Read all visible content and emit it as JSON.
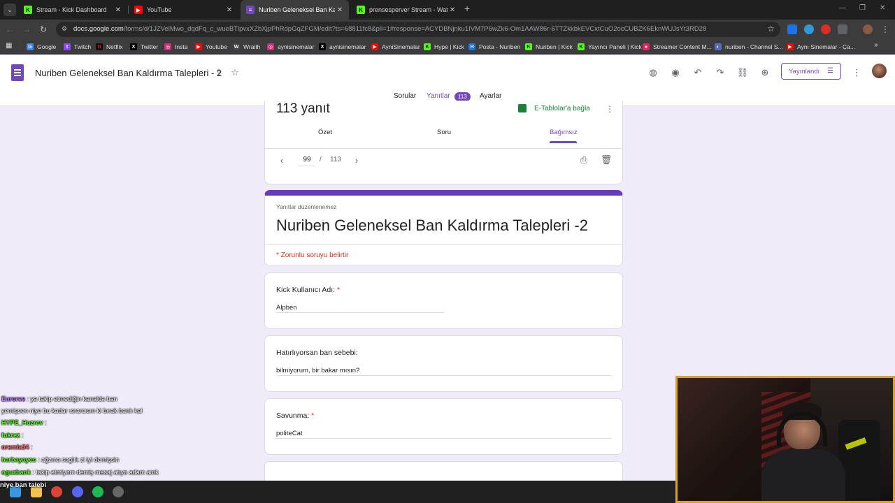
{
  "browser": {
    "tabs": [
      {
        "label": "Stream - Kick Dashboard",
        "icon": "kick-icon"
      },
      {
        "label": "YouTube",
        "icon": "youtube-icon"
      },
      {
        "label": "Nuriben Geleneksel Ban Kaldırı",
        "icon": "forms-icon"
      },
      {
        "label": "prensesperver Stream - Watch l",
        "icon": "kick-icon"
      }
    ],
    "url_host": "docs.google.com",
    "url_path": "/forms/d/1JZVelMwo_dqdFq_c_wueBTlpvxXZbXjpPhRdpGqZFGM/edit?ts=68811fc8&pli=1#response=ACYDBNjnku1IVM7P6wZk6-Om1AAW86r-6TTZkkbkEVCxtCuO2ocCUBZK6EknWUJsYt3RD28",
    "bookmarks": [
      {
        "label": "Google",
        "icon": "google-icon"
      },
      {
        "label": "Twitch",
        "icon": "twitch-icon"
      },
      {
        "label": "Netflix",
        "icon": "netflix-icon"
      },
      {
        "label": "Twitter",
        "icon": "x-icon"
      },
      {
        "label": "Insta",
        "icon": "instagram-icon"
      },
      {
        "label": "Youtube",
        "icon": "youtube-icon"
      },
      {
        "label": "Wraith",
        "icon": "wraith-icon"
      },
      {
        "label": "aynisinemalar",
        "icon": "instagram-icon"
      },
      {
        "label": "aynisinemalar",
        "icon": "x-icon"
      },
      {
        "label": "AyniSinemalar",
        "icon": "youtube-icon"
      },
      {
        "label": "Hype | Kick",
        "icon": "kick-icon"
      },
      {
        "label": "Posta - Nuriben",
        "icon": "mail-icon"
      },
      {
        "label": "Nuriben | Kick",
        "icon": "kick-icon"
      },
      {
        "label": "Yayıncı Paneli | Kick",
        "icon": "kick-icon"
      },
      {
        "label": "Streamer Content M...",
        "icon": "streamer-icon"
      },
      {
        "label": "nuriben - Channel S...",
        "icon": "channel-icon"
      },
      {
        "label": "Aynı Sinemalar - Ça...",
        "icon": "youtube-icon"
      }
    ]
  },
  "forms": {
    "title": "Nuriben Geleneksel Ban Kaldırma Talepleri - 2",
    "tabs": {
      "questions": "Sorular",
      "responses": "Yanıtlar",
      "responses_count": "113",
      "settings": "Ayarlar"
    },
    "publish_label": "Yayınlandı",
    "responses": {
      "count_label": "113 yanıt",
      "sheets_link": "E-Tablolar'a bağla",
      "subtabs": {
        "summary": "Özet",
        "question": "Soru",
        "individual": "Bağımsız"
      },
      "current": "99",
      "total": "113",
      "separator": "/"
    },
    "form_card": {
      "note": "Yanıtlar düzenlenemez",
      "title": "Nuriben Geleneksel Ban Kaldırma Talepleri -2",
      "required_note": "* Zorunlu soruyu belirtir"
    },
    "questions": [
      {
        "label": "Kick Kullanıcı Adı:",
        "required": "*",
        "answer": "Alpben"
      },
      {
        "label": "Hatırlıyorsan ban sebebi:",
        "required": "",
        "answer": "bilmiyorum, bir bakar mısın?"
      },
      {
        "label": "Savunma:",
        "required": "*",
        "answer": "politeCat"
      }
    ]
  },
  "chat": [
    {
      "user": "Eurores",
      "text": ": ya takip etmediğin kanalda ban",
      "color": "#c77dff"
    },
    {
      "user": "",
      "text": "yemişsen niye bu kadar ısrarcısın ki bırak banlı kal",
      "color": "#ffffff"
    },
    {
      "user": "HYPE_Huzrev",
      "text": ":",
      "color": "#53fc18"
    },
    {
      "user": "fukrez",
      "text": ":",
      "color": "#53fc18"
    },
    {
      "user": "oremla34",
      "text": ":",
      "color": "#ff6b6b"
    },
    {
      "user": "harbayayes",
      "text": ": ağzına saglık zi iyi demişsin",
      "color": "#53fc18"
    },
    {
      "user": "oguzbank",
      "text": ": takip etmiyom demiş mesaj atıyo adam amk",
      "color": "#53fc18"
    }
  ],
  "overlay_banner": "niye ban talebi",
  "colors": {
    "accent": "#7248b9",
    "header_bar": "#673ab7",
    "required": "#d93025",
    "sheets": "#188038",
    "page_bg": "#f0ebf8",
    "webcam_border": "#d8a12a"
  }
}
